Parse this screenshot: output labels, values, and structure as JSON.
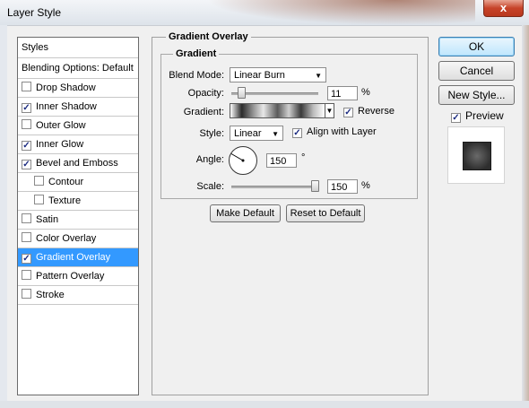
{
  "window": {
    "title": "Layer Style",
    "close_glyph": "x"
  },
  "styles_list": {
    "header": "Styles",
    "blending": "Blending Options: Default",
    "items": [
      {
        "label": "Drop Shadow",
        "checked": false
      },
      {
        "label": "Inner Shadow",
        "checked": true
      },
      {
        "label": "Outer Glow",
        "checked": false
      },
      {
        "label": "Inner Glow",
        "checked": true
      },
      {
        "label": "Bevel and Emboss",
        "checked": true
      },
      {
        "label": "Contour",
        "checked": false
      },
      {
        "label": "Texture",
        "checked": false
      },
      {
        "label": "Satin",
        "checked": false
      },
      {
        "label": "Color Overlay",
        "checked": false
      },
      {
        "label": "Gradient Overlay",
        "checked": true,
        "selected": true
      },
      {
        "label": "Pattern Overlay",
        "checked": false
      },
      {
        "label": "Stroke",
        "checked": false
      }
    ]
  },
  "panel": {
    "section_title": "Gradient Overlay",
    "group_title": "Gradient",
    "blend_mode_label": "Blend Mode:",
    "blend_mode_value": "Linear Burn",
    "opacity_label": "Opacity:",
    "opacity_value": "11",
    "opacity_fraction": 0.11,
    "percent": "%",
    "gradient_label": "Gradient:",
    "reverse_label": "Reverse",
    "reverse_checked": true,
    "style_label": "Style:",
    "style_value": "Linear",
    "align_label": "Align with Layer",
    "align_checked": true,
    "angle_label": "Angle:",
    "angle_value": "150",
    "degree": "°",
    "scale_label": "Scale:",
    "scale_value": "150",
    "scale_fraction": 0.96,
    "make_default": "Make Default",
    "reset_default": "Reset to Default"
  },
  "side": {
    "ok": "OK",
    "cancel": "Cancel",
    "new_style": "New Style...",
    "preview_label": "Preview",
    "preview_checked": true
  },
  "check_glyph": "✓",
  "colors": {
    "selection": "#3399ff",
    "ok_border": "#3c7fb1"
  }
}
